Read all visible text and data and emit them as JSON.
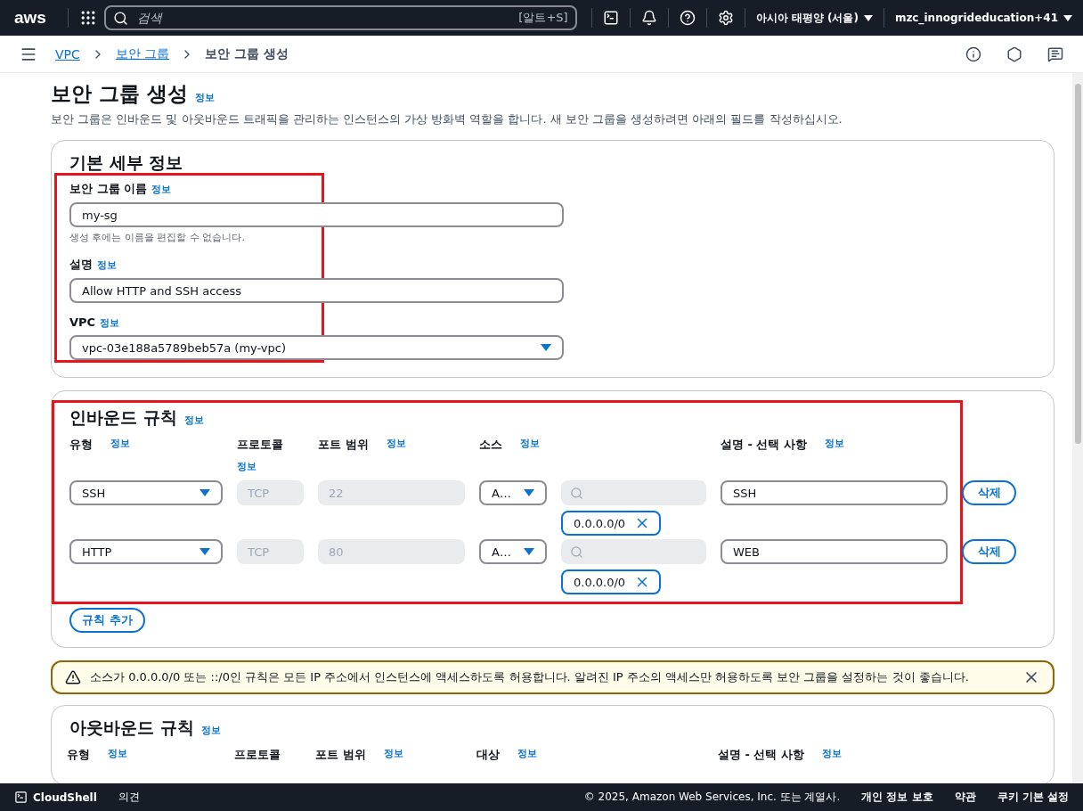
{
  "top_nav": {
    "logo": "aws",
    "search_placeholder": "검색",
    "shortcut": "[알트+S]",
    "region": "아시아 태평양 (서울)",
    "account": "mzc_innogrideducation+41"
  },
  "breadcrumb": [
    {
      "label": "VPC",
      "link": true
    },
    {
      "label": "보안 그룹",
      "link": true
    },
    {
      "label": "보안 그룹 생성",
      "link": false
    }
  ],
  "page": {
    "title": "보안 그룹 생성",
    "info": "정보",
    "description": "보안 그룹은 인바운드 및 아웃바운드 트래픽을 관리하는 인스턴스의 가상 방화벽 역할을 합니다. 새 보안 그룹을 생성하려면 아래의 필드를 작성하십시오."
  },
  "basic": {
    "title": "기본 세부 정보",
    "highlighted": true,
    "fields": [
      {
        "kind": "input",
        "label": "보안 그룹 이름",
        "info": "정보",
        "value": "my-sg",
        "hint": "생성 후에는 이름을 편집할 수 없습니다."
      },
      {
        "kind": "input",
        "label": "설명",
        "info": "정보",
        "value": "Allow HTTP and SSH access"
      },
      {
        "kind": "select",
        "label": "VPC",
        "info": "정보",
        "value": "vpc-03e188a5789beb57a (my-vpc)"
      }
    ]
  },
  "inbound": {
    "title": "인바운드 규칙",
    "info": "정보",
    "highlighted": true,
    "columns": [
      {
        "label": "유형",
        "info": "정보"
      },
      {
        "label": "프로토콜",
        "info": "정보"
      },
      {
        "label": "포트 범위",
        "info": "정보"
      },
      {
        "label": "소스",
        "info": "정보"
      },
      {
        "label": "설명 - 선택 사항",
        "info": "정보"
      }
    ],
    "rules": [
      {
        "type": "SSH",
        "protocol": {
          "value": "TCP",
          "disabled": true
        },
        "port": {
          "value": "22",
          "disabled": true
        },
        "source": "A…",
        "cidr": "0.0.0.0/0",
        "description": "SSH",
        "delete": "삭제"
      },
      {
        "type": "HTTP",
        "protocol": {
          "value": "TCP",
          "disabled": true
        },
        "port": {
          "value": "80",
          "disabled": true
        },
        "source": "A…",
        "cidr": "0.0.0.0/0",
        "description": "WEB",
        "delete": "삭제"
      }
    ],
    "add_button": "규칙 추가"
  },
  "warning": {
    "text": "소스가 0.0.0.0/0 또는 ::/0인 규칙은 모든 IP 주소에서 인스턴스에 액세스하도록 허용합니다. 알려진 IP 주소의 액세스만 허용하도록 보안 그룹을 설정하는 것이 좋습니다."
  },
  "outbound": {
    "title": "아웃바운드 규칙",
    "info": "정보",
    "columns": [
      {
        "label": "유형",
        "info": "정보"
      },
      {
        "label": "프로토콜"
      },
      {
        "label": "포트 범위",
        "info": "정보"
      },
      {
        "label": "대상",
        "info": "정보"
      },
      {
        "label": "설명 - 선택 사항",
        "info": "정보"
      }
    ]
  },
  "footer": {
    "cloudshell": "CloudShell",
    "feedback": "의견",
    "copyright": "© 2025, Amazon Web Services, Inc. 또는 계열사.",
    "links": [
      "개인 정보 보호",
      "약관",
      "쿠키 기본 설정"
    ]
  }
}
